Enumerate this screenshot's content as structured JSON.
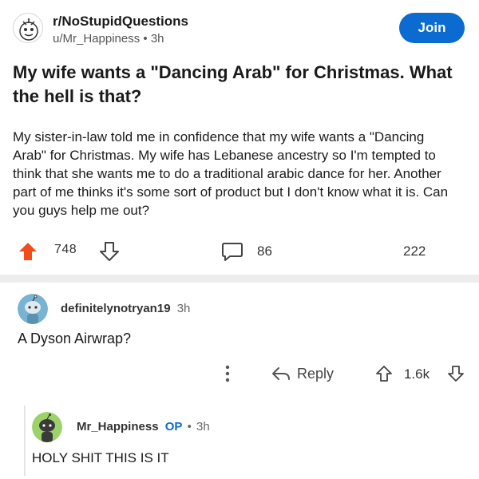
{
  "post": {
    "subreddit": "r/NoStupidQuestions",
    "author": "u/Mr_Happiness",
    "separator": "•",
    "age": "3h",
    "join_label": "Join",
    "title": "My wife wants a \"Dancing Arab\" for Christmas. What the hell is that?",
    "body": "My sister-in-law told me in confidence that my wife wants a \"Dancing Arab\" for Christmas. My wife has Lebanese ancestry so I'm tempted to think that she wants me to do a traditional arabic dance for her. Another part of me thinks it's some sort of product but I don't know what it is. Can you guys help me out?",
    "votes": "748",
    "comments": "86",
    "shares": "222"
  },
  "comments": [
    {
      "user": "definitelynotryan19",
      "age": "3h",
      "text": "A Dyson Airwrap?",
      "reply_label": "Reply",
      "score": "1.6k"
    },
    {
      "user": "Mr_Happiness",
      "op_label": "OP",
      "separator": "•",
      "age": "3h",
      "text": "HOLY SHIT THIS IS IT"
    }
  ],
  "colors": {
    "upvote_active": "#f24c1a",
    "join_button": "#0b6bd1",
    "op_badge": "#0b6bd1",
    "avatar_blue": "#78b3d1",
    "avatar_green": "#9bd26a"
  },
  "icons": {
    "upvote": "arrow-up-filled",
    "downvote": "arrow-down-outline",
    "comment": "speech-bubble-outline",
    "reply": "reply-arrow",
    "more": "vertical-ellipsis"
  }
}
